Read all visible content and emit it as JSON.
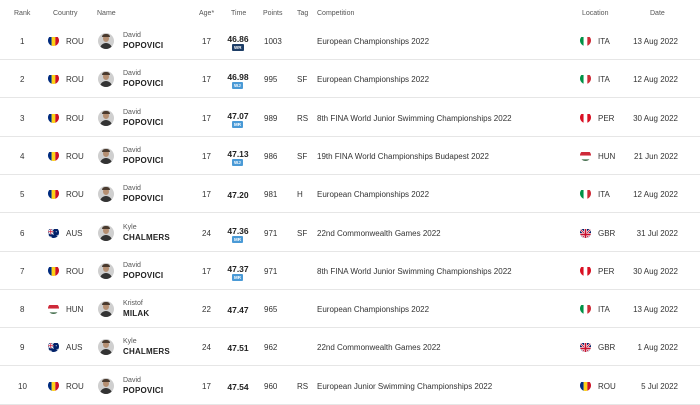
{
  "columns": {
    "rank": "Rank",
    "country": "Country",
    "name": "Name",
    "age": "Age*",
    "time": "Time",
    "points": "Points",
    "tag": "Tag",
    "competition": "Competition",
    "location": "Location",
    "date": "Date"
  },
  "colors": {
    "wr_badge": "#1d3d66",
    "wj_badge": "#4a9ad6",
    "mr_badge": "#4a9ad6"
  },
  "rows": [
    {
      "rank": "1",
      "country": "ROU",
      "country_flag": "romania-flag",
      "first": "David",
      "last": "POPOVICI",
      "age": "17",
      "time": "46.86",
      "badge": "WR",
      "points": "1003",
      "tag": "",
      "competition": "European Championships 2022",
      "loc": "ITA",
      "loc_flag": "italy-flag",
      "date": "13 Aug 2022"
    },
    {
      "rank": "2",
      "country": "ROU",
      "country_flag": "romania-flag",
      "first": "David",
      "last": "POPOVICI",
      "age": "17",
      "time": "46.98",
      "badge": "WJ",
      "points": "995",
      "tag": "SF",
      "competition": "European Championships 2022",
      "loc": "ITA",
      "loc_flag": "italy-flag",
      "date": "12 Aug 2022"
    },
    {
      "rank": "3",
      "country": "ROU",
      "country_flag": "romania-flag",
      "first": "David",
      "last": "POPOVICI",
      "age": "17",
      "time": "47.07",
      "badge": "MR",
      "points": "989",
      "tag": "RS",
      "competition": "8th FINA World Junior Swimming Championships 2022",
      "loc": "PER",
      "loc_flag": "peru-flag",
      "date": "30 Aug 2022"
    },
    {
      "rank": "4",
      "country": "ROU",
      "country_flag": "romania-flag",
      "first": "David",
      "last": "POPOVICI",
      "age": "17",
      "time": "47.13",
      "badge": "WJ",
      "points": "986",
      "tag": "SF",
      "competition": "19th FINA World Championships Budapest 2022",
      "loc": "HUN",
      "loc_flag": "hungary-flag",
      "date": "21 Jun 2022"
    },
    {
      "rank": "5",
      "country": "ROU",
      "country_flag": "romania-flag",
      "first": "David",
      "last": "POPOVICI",
      "age": "17",
      "time": "47.20",
      "badge": "",
      "points": "981",
      "tag": "H",
      "competition": "European Championships 2022",
      "loc": "ITA",
      "loc_flag": "italy-flag",
      "date": "12 Aug 2022"
    },
    {
      "rank": "6",
      "country": "AUS",
      "country_flag": "australia-flag",
      "first": "Kyle",
      "last": "CHALMERS",
      "age": "24",
      "time": "47.36",
      "badge": "MR",
      "points": "971",
      "tag": "SF",
      "competition": "22nd Commonwealth Games 2022",
      "loc": "GBR",
      "loc_flag": "uk-flag",
      "date": "31 Jul 2022"
    },
    {
      "rank": "7",
      "country": "ROU",
      "country_flag": "romania-flag",
      "first": "David",
      "last": "POPOVICI",
      "age": "17",
      "time": "47.37",
      "badge": "MR",
      "points": "971",
      "tag": "",
      "competition": "8th FINA World Junior Swimming Championships 2022",
      "loc": "PER",
      "loc_flag": "peru-flag",
      "date": "30 Aug 2022"
    },
    {
      "rank": "8",
      "country": "HUN",
      "country_flag": "hungary-flag",
      "first": "Kristof",
      "last": "MILAK",
      "age": "22",
      "time": "47.47",
      "badge": "",
      "points": "965",
      "tag": "",
      "competition": "European Championships 2022",
      "loc": "ITA",
      "loc_flag": "italy-flag",
      "date": "13 Aug 2022"
    },
    {
      "rank": "9",
      "country": "AUS",
      "country_flag": "australia-flag",
      "first": "Kyle",
      "last": "CHALMERS",
      "age": "24",
      "time": "47.51",
      "badge": "",
      "points": "962",
      "tag": "",
      "competition": "22nd Commonwealth Games 2022",
      "loc": "GBR",
      "loc_flag": "uk-flag",
      "date": "1 Aug 2022"
    },
    {
      "rank": "10",
      "country": "ROU",
      "country_flag": "romania-flag",
      "first": "David",
      "last": "POPOVICI",
      "age": "17",
      "time": "47.54",
      "badge": "",
      "points": "960",
      "tag": "RS",
      "competition": "European Junior Swimming Championships 2022",
      "loc": "ROU",
      "loc_flag": "romania-flag",
      "date": "5 Jul 2022"
    }
  ]
}
